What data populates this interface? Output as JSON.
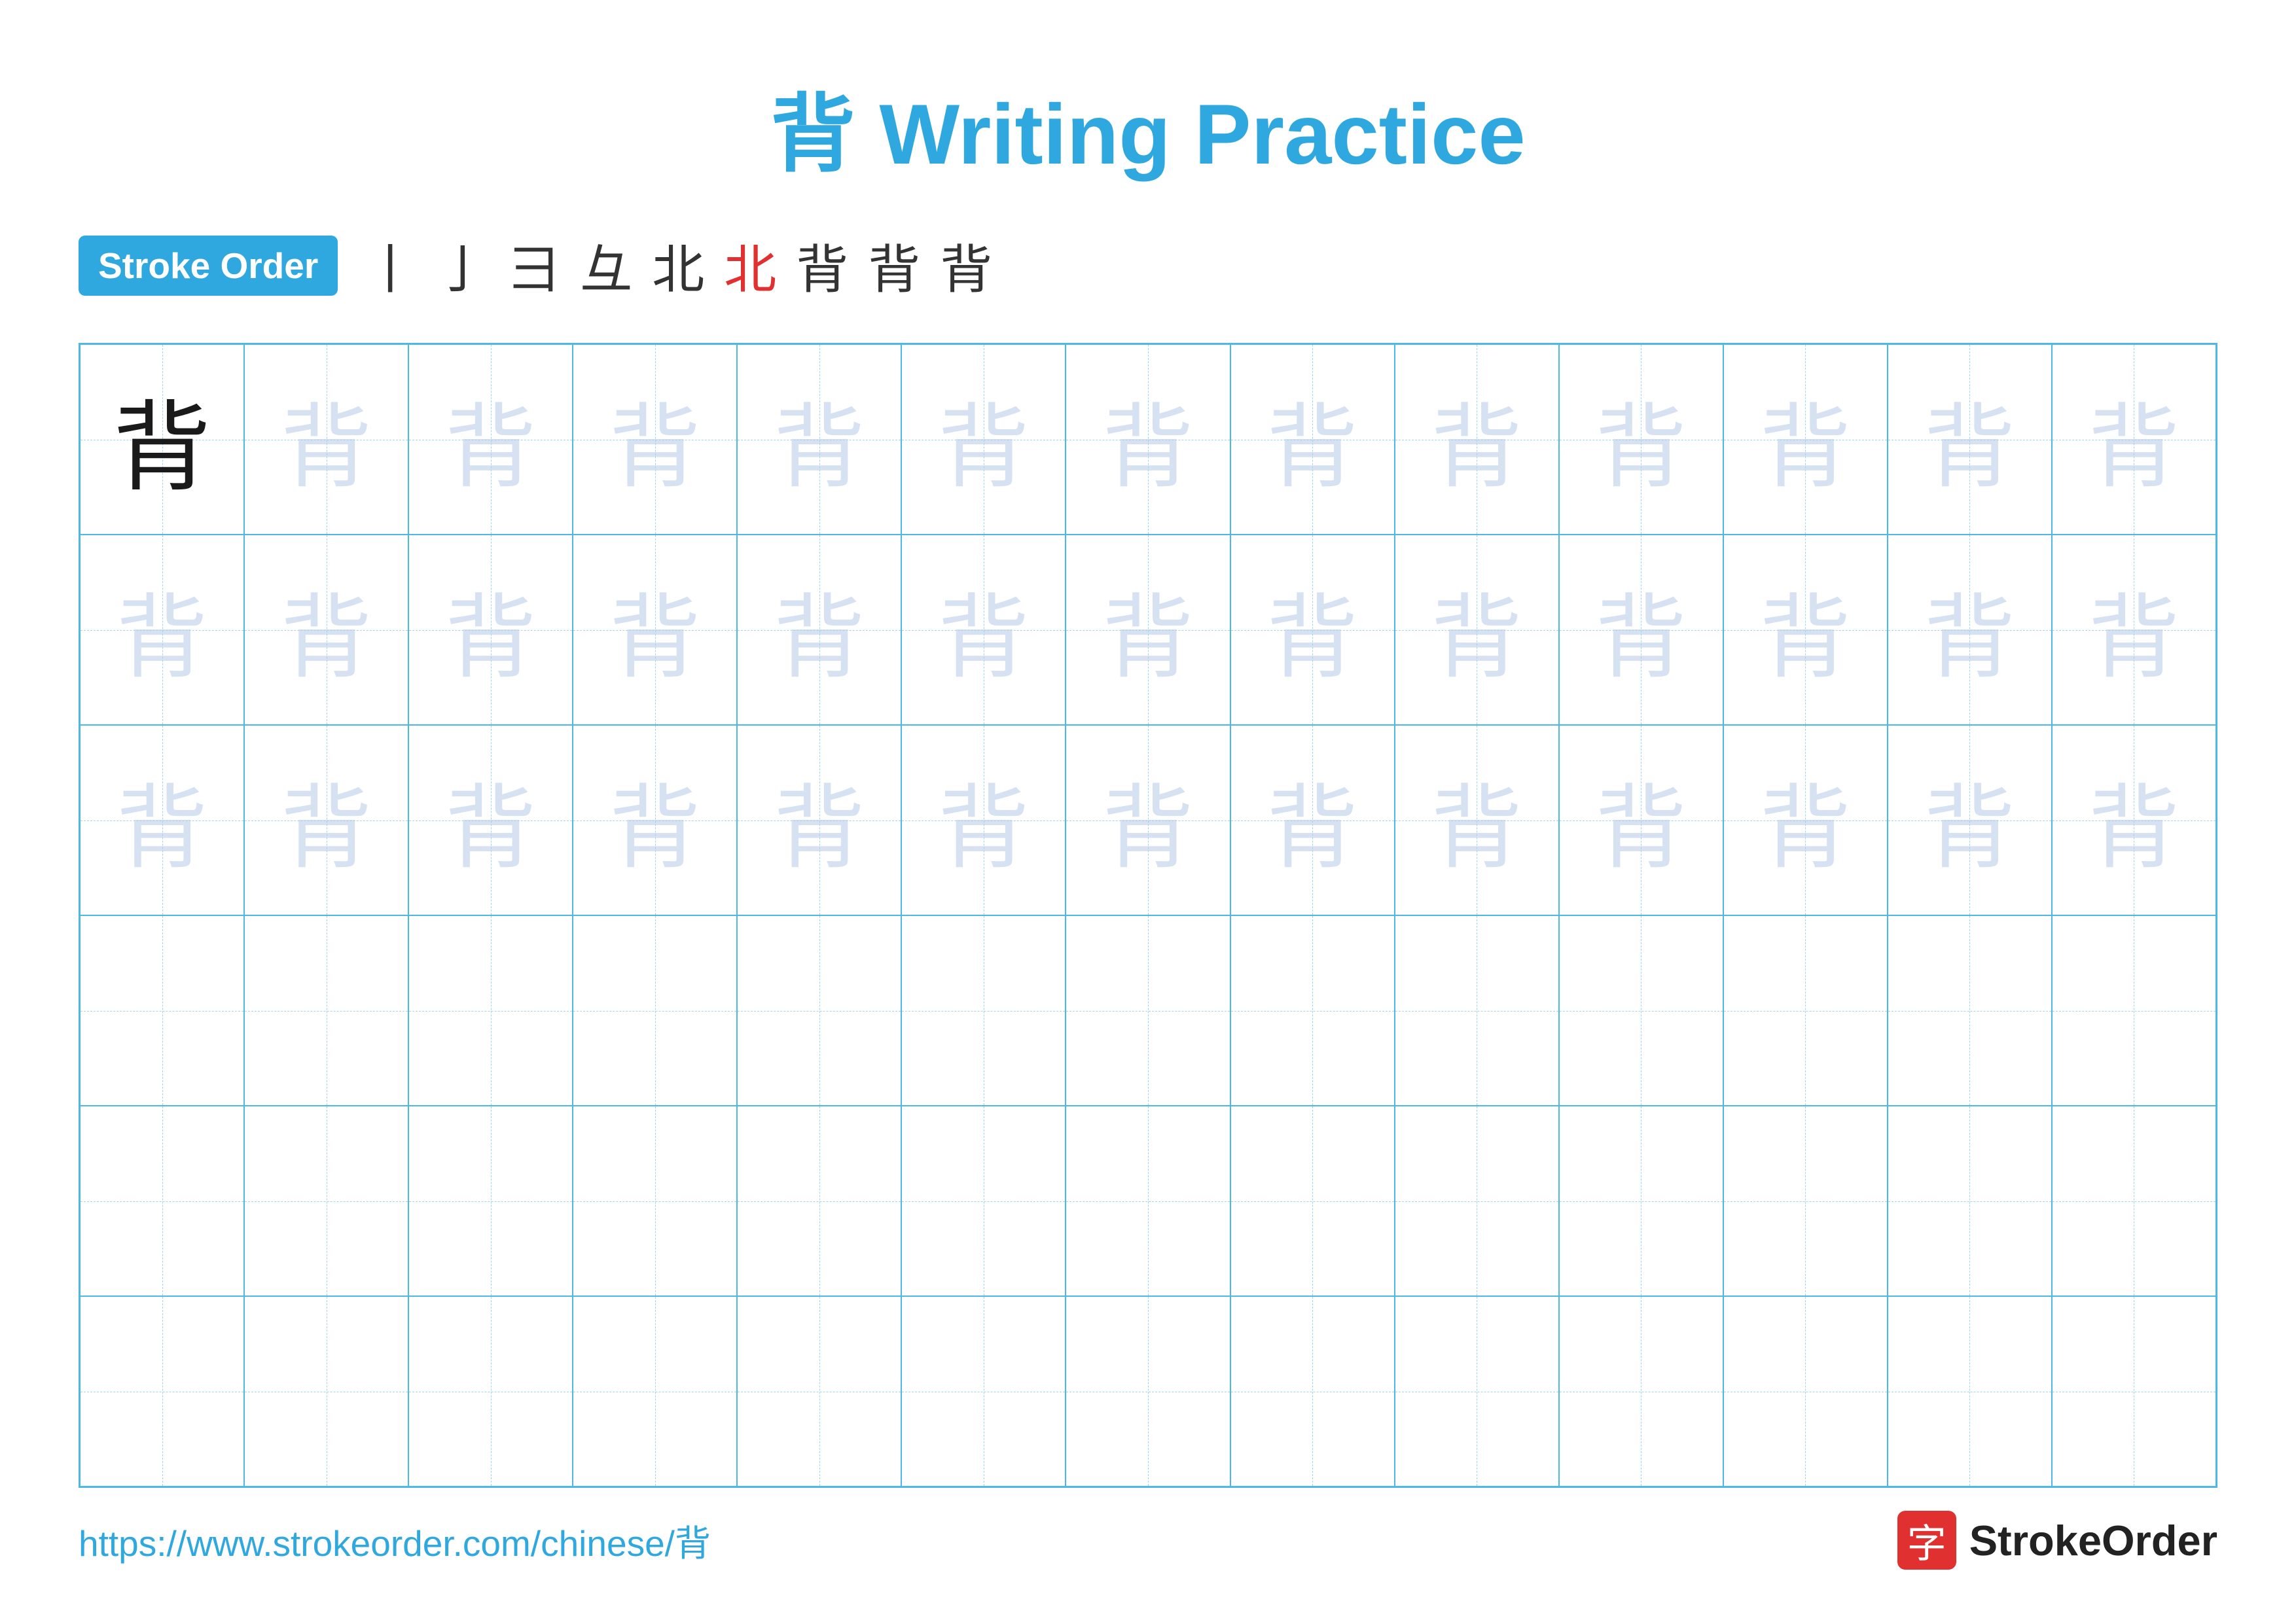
{
  "title": "背 Writing Practice",
  "stroke_order": {
    "badge_label": "Stroke Order",
    "strokes": [
      "丨",
      "亅",
      "𠃌",
      "𠃍",
      "北",
      "北",
      "背",
      "背",
      "背"
    ],
    "red_index": 5
  },
  "grid": {
    "rows": 6,
    "cols": 13
  },
  "footer": {
    "url": "https://www.strokeorder.com/chinese/背",
    "logo_char": "字",
    "logo_text": "StrokeOrder"
  },
  "char": "背",
  "colors": {
    "blue": "#2fa8e0",
    "red": "#e03030",
    "faint": "rgba(180,200,230,0.5)"
  }
}
